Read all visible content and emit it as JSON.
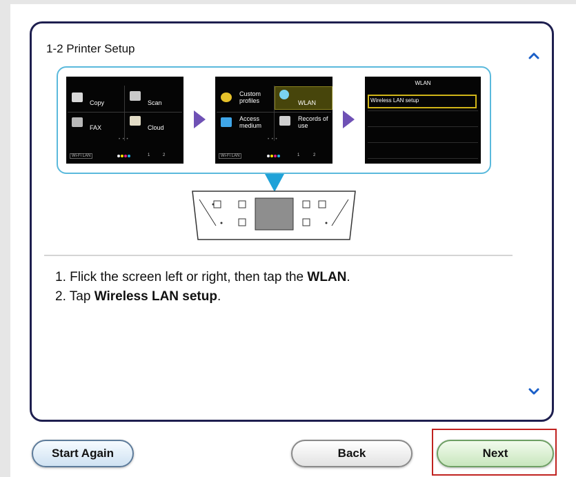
{
  "step_title": "1-2 Printer Setup",
  "illustration": {
    "screen1": {
      "tiles": [
        "Copy",
        "Scan",
        "FAX",
        "Cloud"
      ],
      "status_left": "Wi-Fi LAN",
      "status_right_1": "1",
      "status_right_2": "2"
    },
    "screen2": {
      "tiles": [
        "Custom\nprofiles",
        "WLAN",
        "Access\nmedium",
        "Records of\nuse"
      ],
      "status_left": "Wi-Fi LAN",
      "status_right_1": "1",
      "status_right_2": "2"
    },
    "screen3": {
      "header": "WLAN",
      "item": "Wireless LAN setup"
    }
  },
  "instructions": [
    {
      "prefix": "1. Flick the screen left or right, then tap the ",
      "bold": "WLAN",
      "suffix": "."
    },
    {
      "prefix": "2. Tap ",
      "bold": "Wireless LAN setup",
      "suffix": "."
    }
  ],
  "buttons": {
    "start_again": "Start Again",
    "back": "Back",
    "next": "Next"
  },
  "colors": {
    "frame_border": "#1e1f4f",
    "illustration_border": "#5ab9dc",
    "arrow": "#6f51b5",
    "pointer": "#1fa2d8",
    "next_highlight": "#c0211f",
    "scroll_arrow": "#1a5fc8"
  },
  "icons": {
    "scroll_up": "chevron-up-icon",
    "scroll_down": "chevron-down-icon"
  }
}
